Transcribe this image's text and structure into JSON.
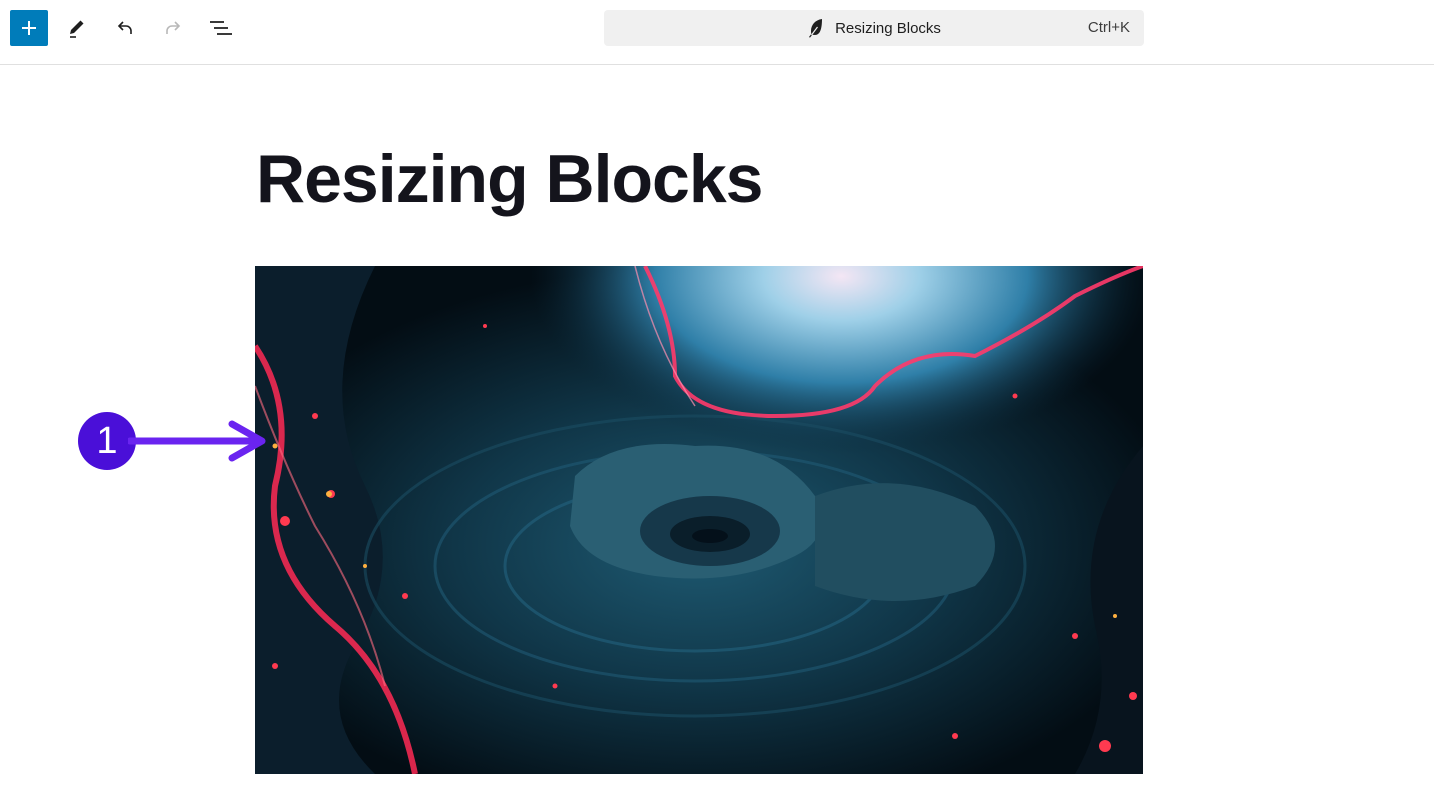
{
  "toolbar": {
    "add_block_icon": "plus-icon",
    "tools_icon": "pencil-icon",
    "undo_icon": "undo-icon",
    "redo_icon": "redo-icon",
    "list_view_icon": "list-view-icon",
    "accent_color": "#007cba"
  },
  "command_bar": {
    "icon": "feather-icon",
    "title": "Resizing Blocks",
    "shortcut": "Ctrl+K"
  },
  "post": {
    "title": "Resizing Blocks"
  },
  "annotation": {
    "number": "1",
    "color": "#4a0fd8"
  }
}
